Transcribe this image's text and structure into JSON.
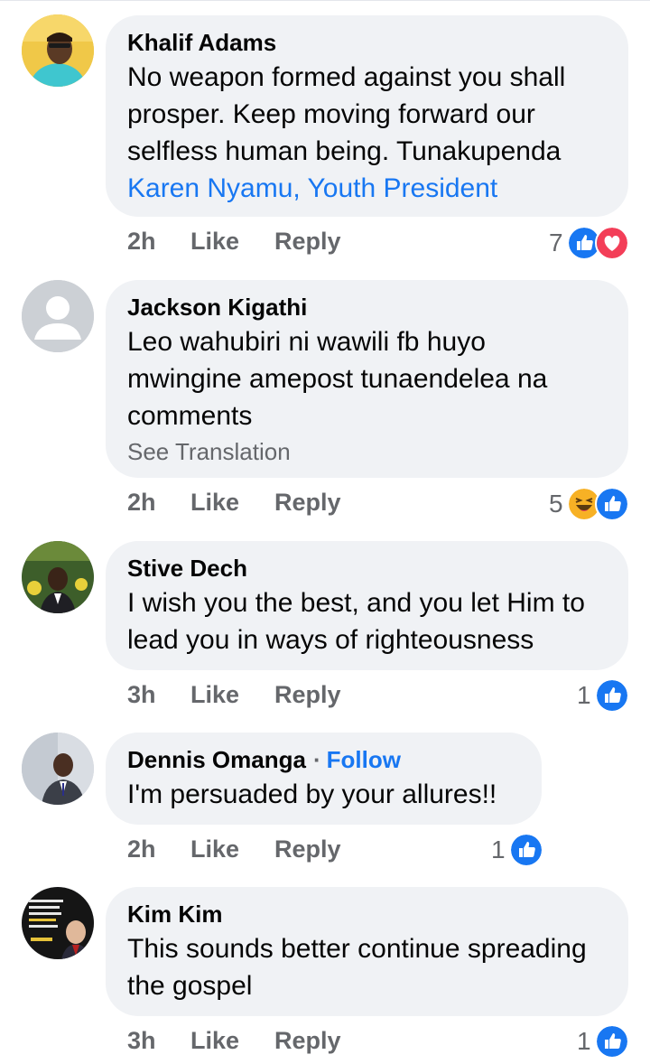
{
  "comments": [
    {
      "author": "Khalif Adams",
      "text": "No weapon formed against you shall prosper. Keep moving forward our selfless human being.  Tunakupenda",
      "mention": "Karen Nyamu, Youth President",
      "time": "2h",
      "like_label": "Like",
      "reply_label": "Reply",
      "reaction_count": "7",
      "reactions": [
        "like-reaction-icon",
        "love-reaction-icon"
      ]
    },
    {
      "author": "Jackson Kigathi",
      "text": "Leo wahubiri ni wawili fb huyo mwingine amepost tunaendelea na comments",
      "see_translation": "See Translation",
      "time": "2h",
      "like_label": "Like",
      "reply_label": "Reply",
      "reaction_count": "5",
      "reactions": [
        "haha-reaction-icon",
        "like-reaction-icon"
      ]
    },
    {
      "author": "Stive Dech",
      "text": "I wish you the best, and you let Him to lead you in ways of righteousness",
      "time": "3h",
      "like_label": "Like",
      "reply_label": "Reply",
      "reaction_count": "1",
      "reactions": [
        "like-reaction-icon"
      ]
    },
    {
      "author": "Dennis Omanga",
      "separator": "·",
      "follow_label": "Follow",
      "text": "I'm persuaded by your allures!!",
      "time": "2h",
      "like_label": "Like",
      "reply_label": "Reply",
      "reaction_count": "1",
      "reactions": [
        "like-reaction-icon"
      ]
    },
    {
      "author": "Kim Kim",
      "text": "This sounds better continue spreading the gospel",
      "time": "3h",
      "like_label": "Like",
      "reply_label": "Reply",
      "reaction_count": "1",
      "reactions": [
        "like-reaction-icon"
      ]
    }
  ],
  "colors": {
    "link": "#1877f2",
    "bubble": "#f0f2f5",
    "meta": "#65676b",
    "love": "#f33e58",
    "haha": "#f7b125"
  }
}
